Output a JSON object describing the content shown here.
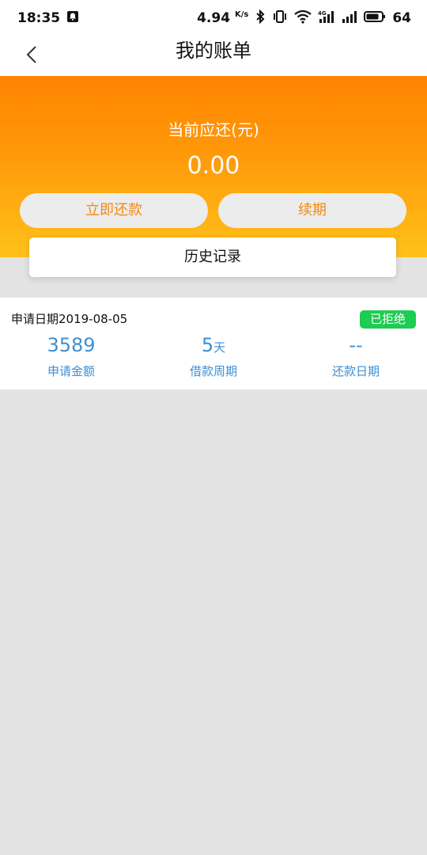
{
  "status_bar": {
    "time": "18:35",
    "net_speed": "4.94",
    "net_unit": "K/s",
    "network_type": "4G",
    "battery": "64"
  },
  "nav": {
    "title": "我的账单"
  },
  "summary": {
    "label": "当前应还(元)",
    "amount": "0.00",
    "repay_button": "立即还款",
    "renew_button": "续期",
    "history_button": "历史记录"
  },
  "record": {
    "apply_date": "申请日期2019-08-05",
    "status": "已拒绝",
    "amount_value": "3589",
    "amount_label": "申请金额",
    "period_value": "5",
    "period_unit": "天",
    "period_label": "借款周期",
    "repay_date_value": "--",
    "repay_date_label": "还款日期"
  },
  "colors": {
    "header_top": "#ff8300",
    "header_bottom": "#ffc219",
    "button_text": "#f28a12",
    "stat_blue": "#3d8fd4",
    "badge_green": "#1bcd51"
  }
}
